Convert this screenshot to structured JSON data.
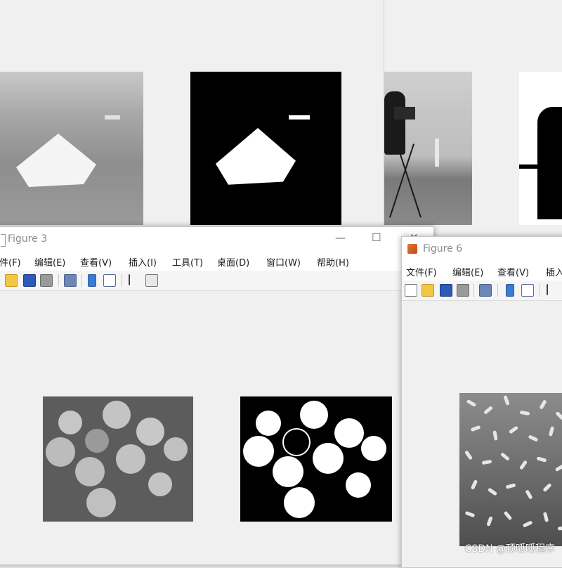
{
  "figure3": {
    "title": "Figure 3",
    "menus": [
      "件(F)",
      "编辑(E)",
      "查看(V)",
      "插入(I)",
      "工具(T)",
      "桌面(D)",
      "窗口(W)",
      "帮助(H)"
    ],
    "controls": [
      "—",
      "☐",
      "✕"
    ]
  },
  "figure6": {
    "title": "Figure 6",
    "menus": [
      "文件(F)",
      "编辑(E)",
      "查看(V)",
      "插入"
    ]
  },
  "icons": [
    "new-file-icon",
    "open-folder-icon",
    "save-icon",
    "print-icon",
    "print-preview-icon",
    "link-plot-icon",
    "insert-legend-icon",
    "pointer-icon",
    "edit-plot-icon"
  ],
  "colors": {
    "window_bg": "#f0f0f0",
    "titlebar": "#ffffff",
    "title_text": "#8a8a8a"
  },
  "watermark": "CSDN @顶呱呱程序"
}
